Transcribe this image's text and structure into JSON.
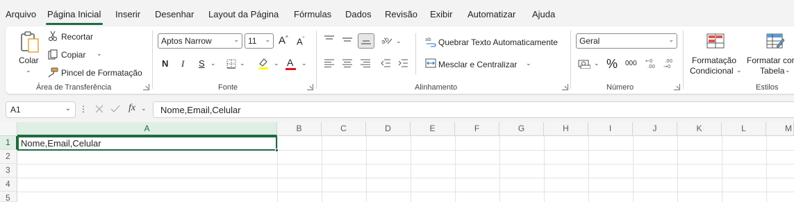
{
  "menu": {
    "tabs": [
      "Arquivo",
      "Página Inicial",
      "Inserir",
      "Desenhar",
      "Layout da Página",
      "Fórmulas",
      "Dados",
      "Revisão",
      "Exibir",
      "Automatizar",
      "Ajuda"
    ],
    "active": "Página Inicial"
  },
  "ribbon": {
    "clipboard": {
      "paste_label": "Colar",
      "cut_label": "Recortar",
      "copy_label": "Copiar",
      "format_painter_label": "Pincel de Formatação",
      "group_label": "Área de Transferência"
    },
    "font": {
      "font_name": "Aptos Narrow",
      "font_size": "11",
      "bold": "N",
      "italic": "I",
      "underline": "S",
      "grow": "A",
      "shrink": "A",
      "color_letter": "A",
      "group_label": "Fonte",
      "highlight_color": "#ffff00",
      "font_color": "#e81123"
    },
    "alignment": {
      "wrap_text_label": "Quebrar Texto Automaticamente",
      "merge_center_label": "Mesclar e Centralizar",
      "group_label": "Alinhamento"
    },
    "number": {
      "format": "Geral",
      "percent": "%",
      "thousands": "000",
      "group_label": "Número"
    },
    "styles": {
      "conditional_label_1": "Formatação",
      "conditional_label_2": "Condicional",
      "table_label_1": "Formatar cor",
      "table_label_2": "Tabela",
      "group_label": "Estilos"
    }
  },
  "formula_bar": {
    "name_box": "A1",
    "fx": "fx",
    "content": "Nome,Email,Celular"
  },
  "sheet": {
    "columns": [
      "A",
      "B",
      "C",
      "D",
      "E",
      "F",
      "G",
      "H",
      "I",
      "J",
      "K",
      "L",
      "M"
    ],
    "rows": [
      "1",
      "2",
      "3",
      "4",
      "5"
    ],
    "cell_a1": "Nome,Email,Celular"
  },
  "colors": {
    "accent": "#1d6b3f"
  }
}
